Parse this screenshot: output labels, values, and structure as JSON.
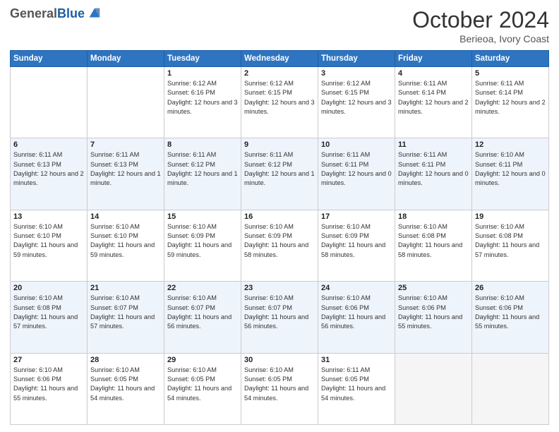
{
  "header": {
    "logo_general": "General",
    "logo_blue": "Blue",
    "month_title": "October 2024",
    "subtitle": "Berieoa, Ivory Coast"
  },
  "days_of_week": [
    "Sunday",
    "Monday",
    "Tuesday",
    "Wednesday",
    "Thursday",
    "Friday",
    "Saturday"
  ],
  "weeks": [
    [
      {
        "day": "",
        "empty": true
      },
      {
        "day": "",
        "empty": true
      },
      {
        "day": "1",
        "sunrise": "6:12 AM",
        "sunset": "6:16 PM",
        "daylight": "12 hours and 3 minutes."
      },
      {
        "day": "2",
        "sunrise": "6:12 AM",
        "sunset": "6:15 PM",
        "daylight": "12 hours and 3 minutes."
      },
      {
        "day": "3",
        "sunrise": "6:12 AM",
        "sunset": "6:15 PM",
        "daylight": "12 hours and 3 minutes."
      },
      {
        "day": "4",
        "sunrise": "6:11 AM",
        "sunset": "6:14 PM",
        "daylight": "12 hours and 2 minutes."
      },
      {
        "day": "5",
        "sunrise": "6:11 AM",
        "sunset": "6:14 PM",
        "daylight": "12 hours and 2 minutes."
      }
    ],
    [
      {
        "day": "6",
        "sunrise": "6:11 AM",
        "sunset": "6:13 PM",
        "daylight": "12 hours and 2 minutes."
      },
      {
        "day": "7",
        "sunrise": "6:11 AM",
        "sunset": "6:13 PM",
        "daylight": "12 hours and 1 minute."
      },
      {
        "day": "8",
        "sunrise": "6:11 AM",
        "sunset": "6:12 PM",
        "daylight": "12 hours and 1 minute."
      },
      {
        "day": "9",
        "sunrise": "6:11 AM",
        "sunset": "6:12 PM",
        "daylight": "12 hours and 1 minute."
      },
      {
        "day": "10",
        "sunrise": "6:11 AM",
        "sunset": "6:11 PM",
        "daylight": "12 hours and 0 minutes."
      },
      {
        "day": "11",
        "sunrise": "6:11 AM",
        "sunset": "6:11 PM",
        "daylight": "12 hours and 0 minutes."
      },
      {
        "day": "12",
        "sunrise": "6:10 AM",
        "sunset": "6:11 PM",
        "daylight": "12 hours and 0 minutes."
      }
    ],
    [
      {
        "day": "13",
        "sunrise": "6:10 AM",
        "sunset": "6:10 PM",
        "daylight": "11 hours and 59 minutes."
      },
      {
        "day": "14",
        "sunrise": "6:10 AM",
        "sunset": "6:10 PM",
        "daylight": "11 hours and 59 minutes."
      },
      {
        "day": "15",
        "sunrise": "6:10 AM",
        "sunset": "6:09 PM",
        "daylight": "11 hours and 59 minutes."
      },
      {
        "day": "16",
        "sunrise": "6:10 AM",
        "sunset": "6:09 PM",
        "daylight": "11 hours and 58 minutes."
      },
      {
        "day": "17",
        "sunrise": "6:10 AM",
        "sunset": "6:09 PM",
        "daylight": "11 hours and 58 minutes."
      },
      {
        "day": "18",
        "sunrise": "6:10 AM",
        "sunset": "6:08 PM",
        "daylight": "11 hours and 58 minutes."
      },
      {
        "day": "19",
        "sunrise": "6:10 AM",
        "sunset": "6:08 PM",
        "daylight": "11 hours and 57 minutes."
      }
    ],
    [
      {
        "day": "20",
        "sunrise": "6:10 AM",
        "sunset": "6:08 PM",
        "daylight": "11 hours and 57 minutes."
      },
      {
        "day": "21",
        "sunrise": "6:10 AM",
        "sunset": "6:07 PM",
        "daylight": "11 hours and 57 minutes."
      },
      {
        "day": "22",
        "sunrise": "6:10 AM",
        "sunset": "6:07 PM",
        "daylight": "11 hours and 56 minutes."
      },
      {
        "day": "23",
        "sunrise": "6:10 AM",
        "sunset": "6:07 PM",
        "daylight": "11 hours and 56 minutes."
      },
      {
        "day": "24",
        "sunrise": "6:10 AM",
        "sunset": "6:06 PM",
        "daylight": "11 hours and 56 minutes."
      },
      {
        "day": "25",
        "sunrise": "6:10 AM",
        "sunset": "6:06 PM",
        "daylight": "11 hours and 55 minutes."
      },
      {
        "day": "26",
        "sunrise": "6:10 AM",
        "sunset": "6:06 PM",
        "daylight": "11 hours and 55 minutes."
      }
    ],
    [
      {
        "day": "27",
        "sunrise": "6:10 AM",
        "sunset": "6:06 PM",
        "daylight": "11 hours and 55 minutes."
      },
      {
        "day": "28",
        "sunrise": "6:10 AM",
        "sunset": "6:05 PM",
        "daylight": "11 hours and 54 minutes."
      },
      {
        "day": "29",
        "sunrise": "6:10 AM",
        "sunset": "6:05 PM",
        "daylight": "11 hours and 54 minutes."
      },
      {
        "day": "30",
        "sunrise": "6:10 AM",
        "sunset": "6:05 PM",
        "daylight": "11 hours and 54 minutes."
      },
      {
        "day": "31",
        "sunrise": "6:11 AM",
        "sunset": "6:05 PM",
        "daylight": "11 hours and 54 minutes."
      },
      {
        "day": "",
        "empty": true
      },
      {
        "day": "",
        "empty": true
      }
    ]
  ]
}
